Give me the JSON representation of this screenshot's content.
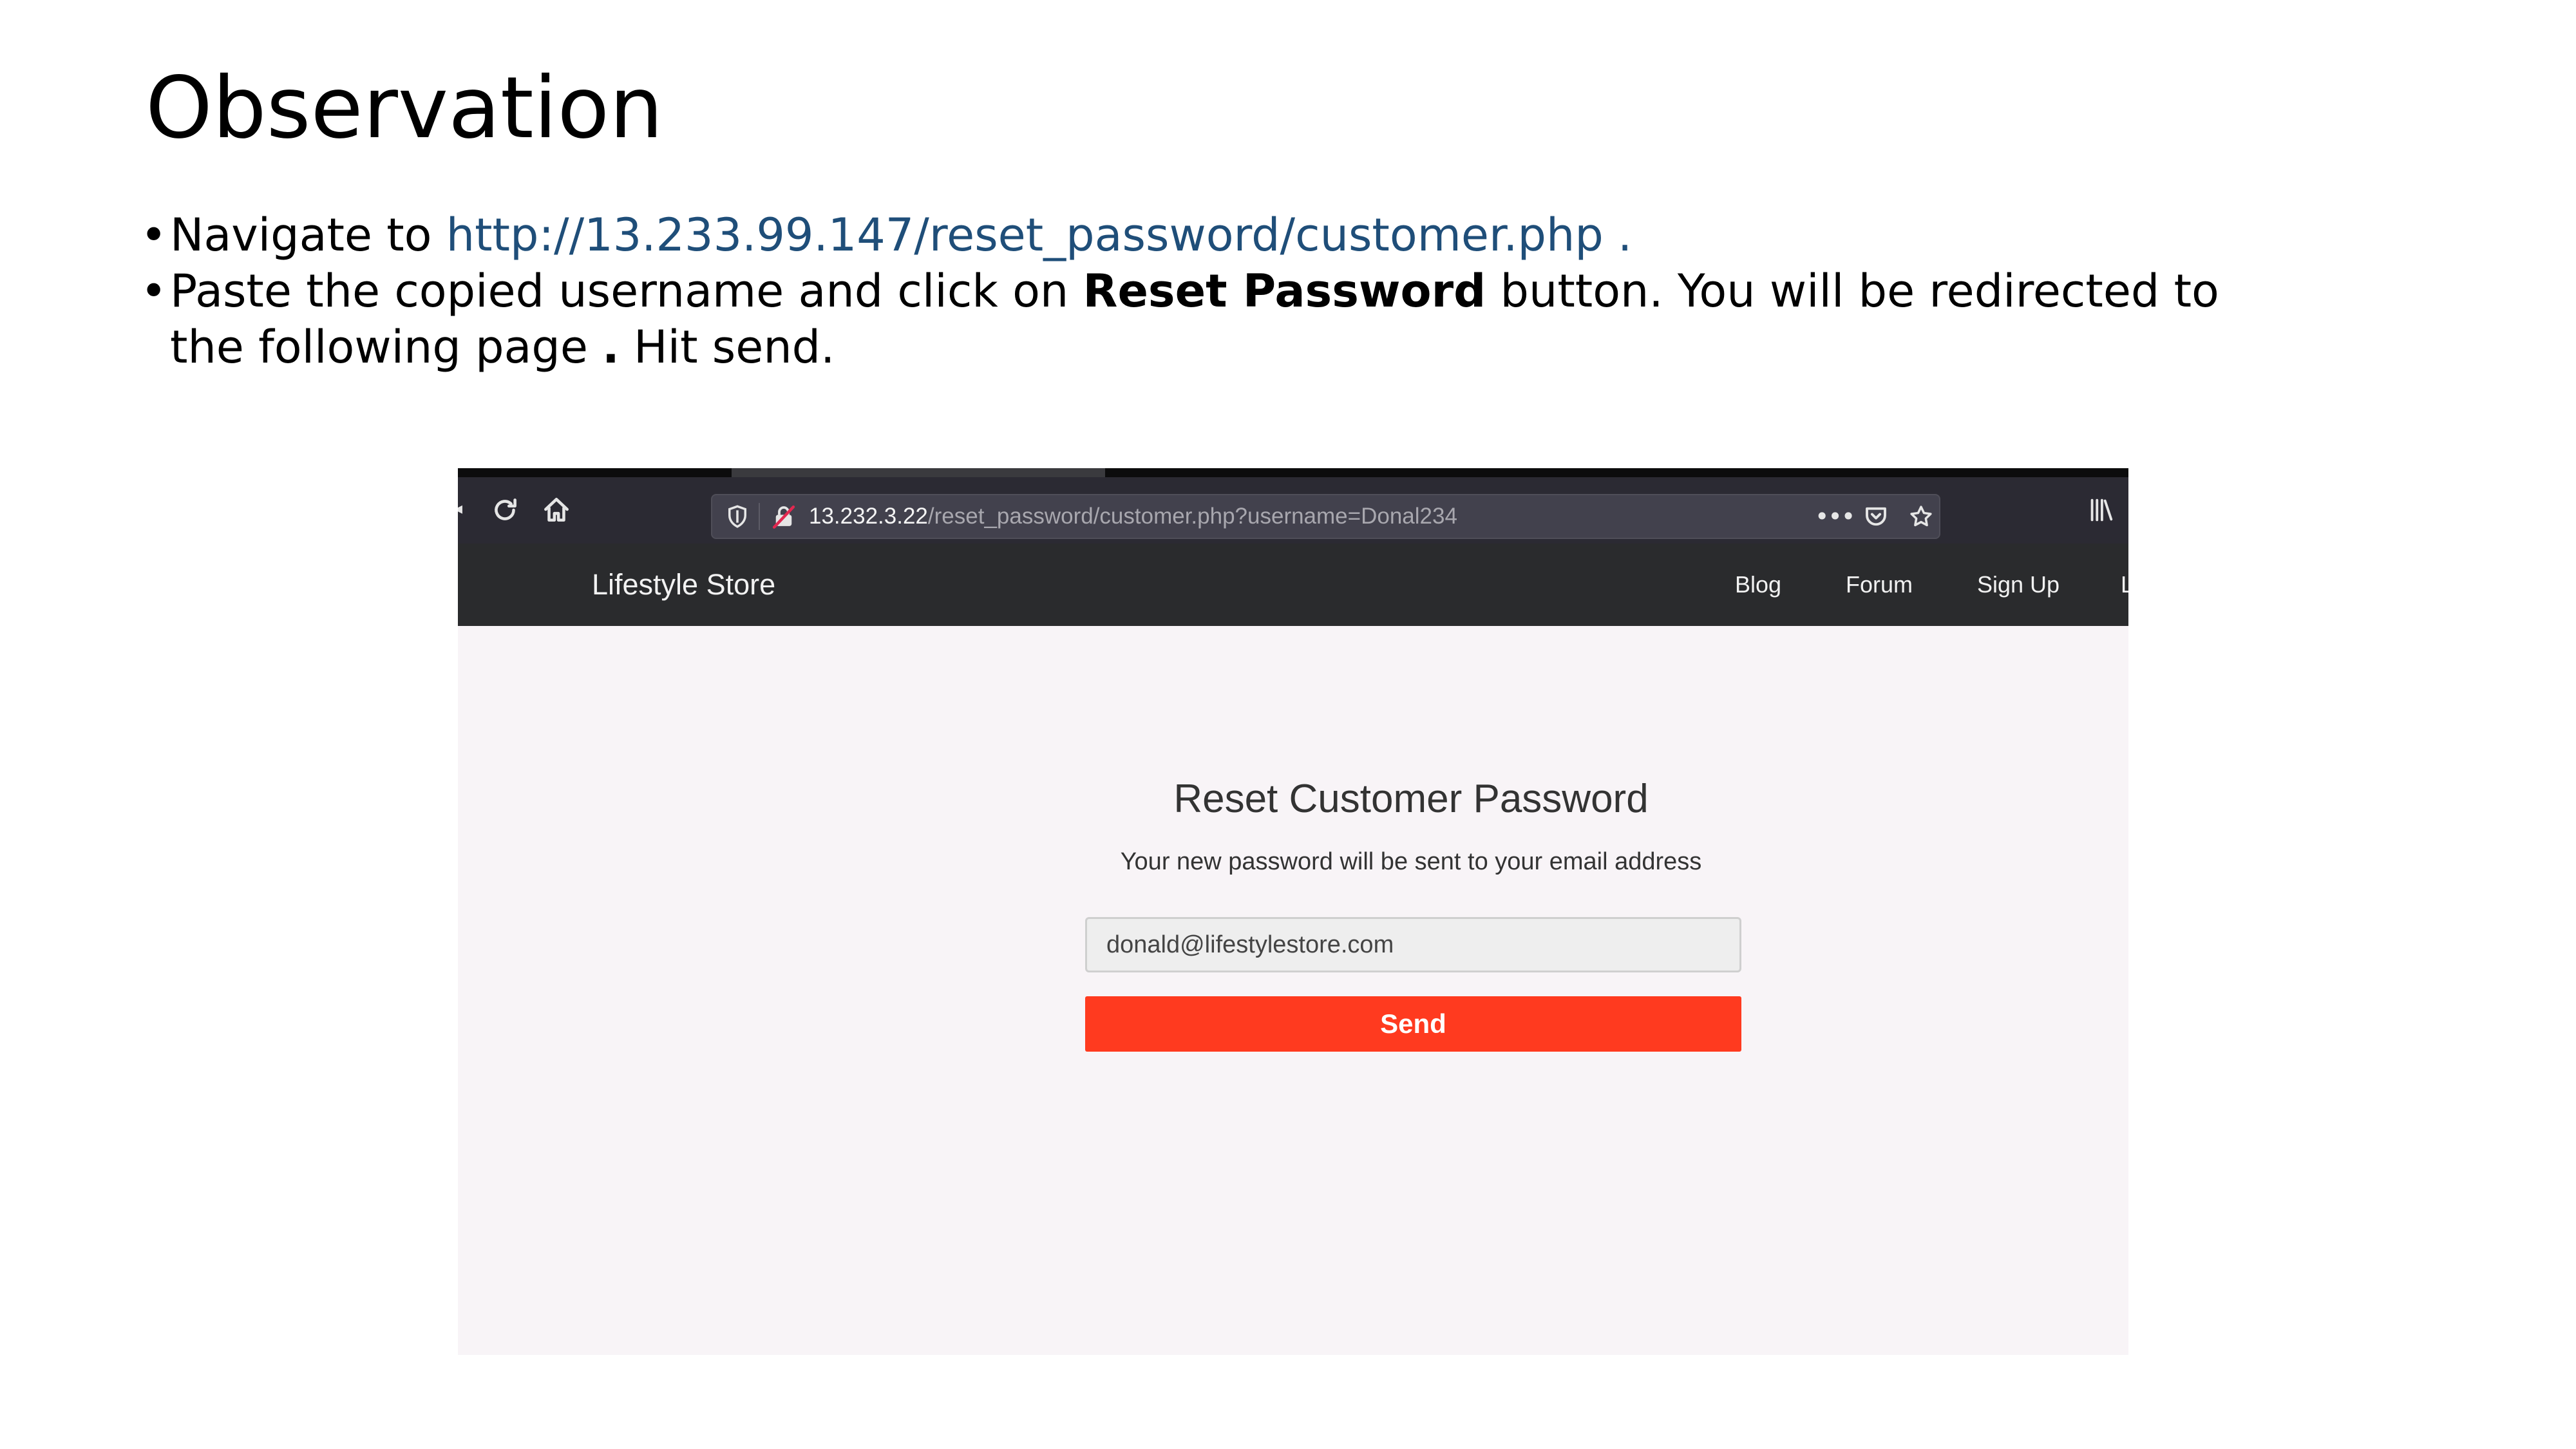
{
  "slide": {
    "title": "Observation",
    "bullets": {
      "b1_prefix": "Navigate to ",
      "b1_link": "http://13.233.99.147/reset_password/customer.php .",
      "b2_part1": "Paste the copied username and click on ",
      "b2_bold1": "Reset Password",
      "b2_part2": " button. You will be redirected to the following page ",
      "b2_bold2": ".",
      "b2_part3": " Hit send."
    }
  },
  "browser": {
    "url_host": "13.232.3.22",
    "url_path": "/reset_password/customer.php?username=Donal234",
    "icons": {
      "reload": "reload-icon",
      "home": "home-icon",
      "shield": "shield-icon",
      "insecure_lock": "insecure-lock-icon",
      "more": "more-icon",
      "pocket": "pocket-icon",
      "bookmark_star": "star-icon",
      "library": "library-icon"
    }
  },
  "site": {
    "brand": "Lifestyle Store",
    "nav": {
      "blog": "Blog",
      "forum": "Forum",
      "signup": "Sign Up",
      "cut": "L"
    },
    "page": {
      "title": "Reset Customer Password",
      "subtitle": "Your new password will be sent to your email address",
      "email_value": "donald@lifestylestore.com",
      "send_label": "Send"
    }
  },
  "colors": {
    "link": "#1f4e79",
    "navbar_bg": "#2a2b2d",
    "toolbar_bg": "#2b2a33",
    "content_bg": "#f8f4f7",
    "send_button": "#ff3a1f"
  }
}
